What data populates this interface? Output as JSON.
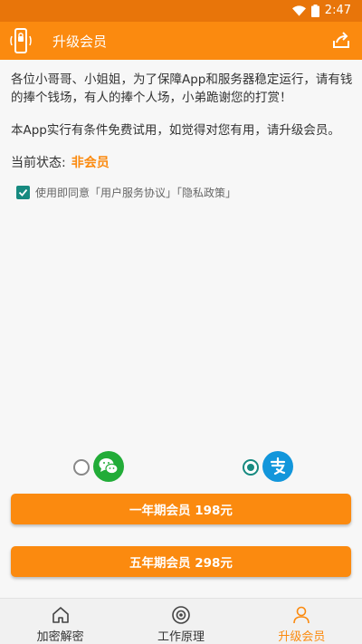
{
  "status_bar": {
    "time": "2:47"
  },
  "app_bar": {
    "title": "升级会员",
    "logo_icon": "phone-lock-icon",
    "share_icon": "share-icon"
  },
  "content": {
    "paragraph1": "各位小哥哥、小姐姐，为了保障App和服务器稳定运行，请有钱的捧个钱场，有人的捧个人场，小弟跪谢您的打赏！",
    "paragraph2": "本App实行有条件免费试用，如觉得对您有用，请升级会员。",
    "status_label": "当前状态:",
    "status_value": "非会员"
  },
  "agreement": {
    "checked": true,
    "text": "使用即同意「用户服务协议」「隐私政策」"
  },
  "payment": {
    "wechat": {
      "selected": false,
      "icon": "wechat-icon",
      "color": "#22ac38"
    },
    "alipay": {
      "selected": true,
      "icon": "alipay-icon",
      "color": "#1296db"
    }
  },
  "buttons": {
    "one_year": "一年期会员 198元",
    "five_year": "五年期会员 298元"
  },
  "bottom_nav": {
    "items": [
      {
        "label": "加密解密",
        "icon": "home-icon",
        "active": false
      },
      {
        "label": "工作原理",
        "icon": "gear-icon",
        "active": false
      },
      {
        "label": "升级会员",
        "icon": "user-icon",
        "active": true
      }
    ]
  },
  "colors": {
    "accent": "#fb8a0f",
    "status_bar": "#e8750a",
    "teal": "#178a80"
  }
}
